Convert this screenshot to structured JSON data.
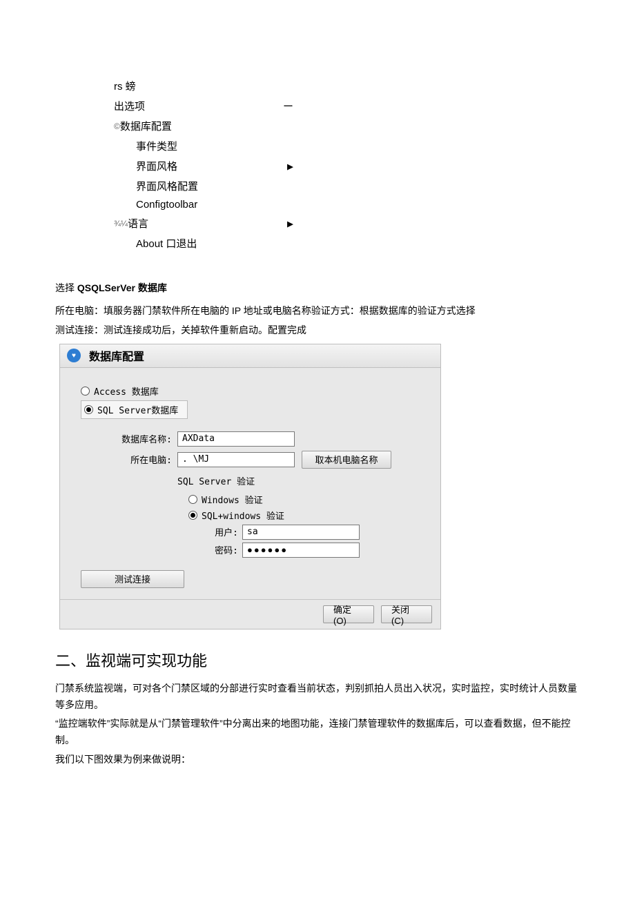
{
  "menu": {
    "row0": "rs 螃",
    "row1_label": "出选项",
    "row1_right": "ー",
    "row2_prefix": "©",
    "row2_label": "数据库配置",
    "row3": "事件类型",
    "row4_label": "界面风格",
    "row4_right": "▶",
    "row5": "界面风格配置",
    "row6": "Configtoolbar",
    "row7_prefix": "¾¼",
    "row7_label": "语言",
    "row7_right": "▶",
    "row8": "About 口退出"
  },
  "intro": {
    "select_label": "选择",
    "select_bold": "QSQLSerVer",
    "select_tail": "数据库",
    "line1": "所在电脑：填服务器门禁软件所在电脑的 IP 地址或电脑名称验证方式：根据数据库的验证方式选择",
    "line2": "测试连接：测试连接成功后，关掉软件重新启动。配置完成"
  },
  "dialog": {
    "title": "数据库配置",
    "radio_access": "Access 数据库",
    "radio_sqlserver": "SQL Server数据库",
    "db_name_label": "数据库名称:",
    "db_name_value": "AXData",
    "host_label": "所在电脑:",
    "host_value": ". \\MJ",
    "host_btn": "取本机电脑名称",
    "auth_heading": "SQL Server 验证",
    "auth_windows": "Windows 验证",
    "auth_sql_windows": "SQL+windows 验证",
    "user_label": "用户:",
    "user_value": "sa",
    "pwd_label": "密码:",
    "pwd_value": "●●●●●●",
    "test_btn": "测试连接",
    "ok_btn": "确定(O)",
    "close_btn": "关闭(C)"
  },
  "section2": {
    "heading": "二、监视端可实现功能",
    "p1": "门禁系统监视端，可对各个门禁区域的分部进行实时查看当前状态，判别抓拍人员出入状况，实时监控，实时统计人员数量等多应用。",
    "p2": "“监控端软件”实际就是从“门禁管理软件”中分离出来的地图功能，连接门禁管理软件的数据库后，可以查看数据，但不能控制。",
    "p3": "我们以下图效果为例来做说明："
  }
}
